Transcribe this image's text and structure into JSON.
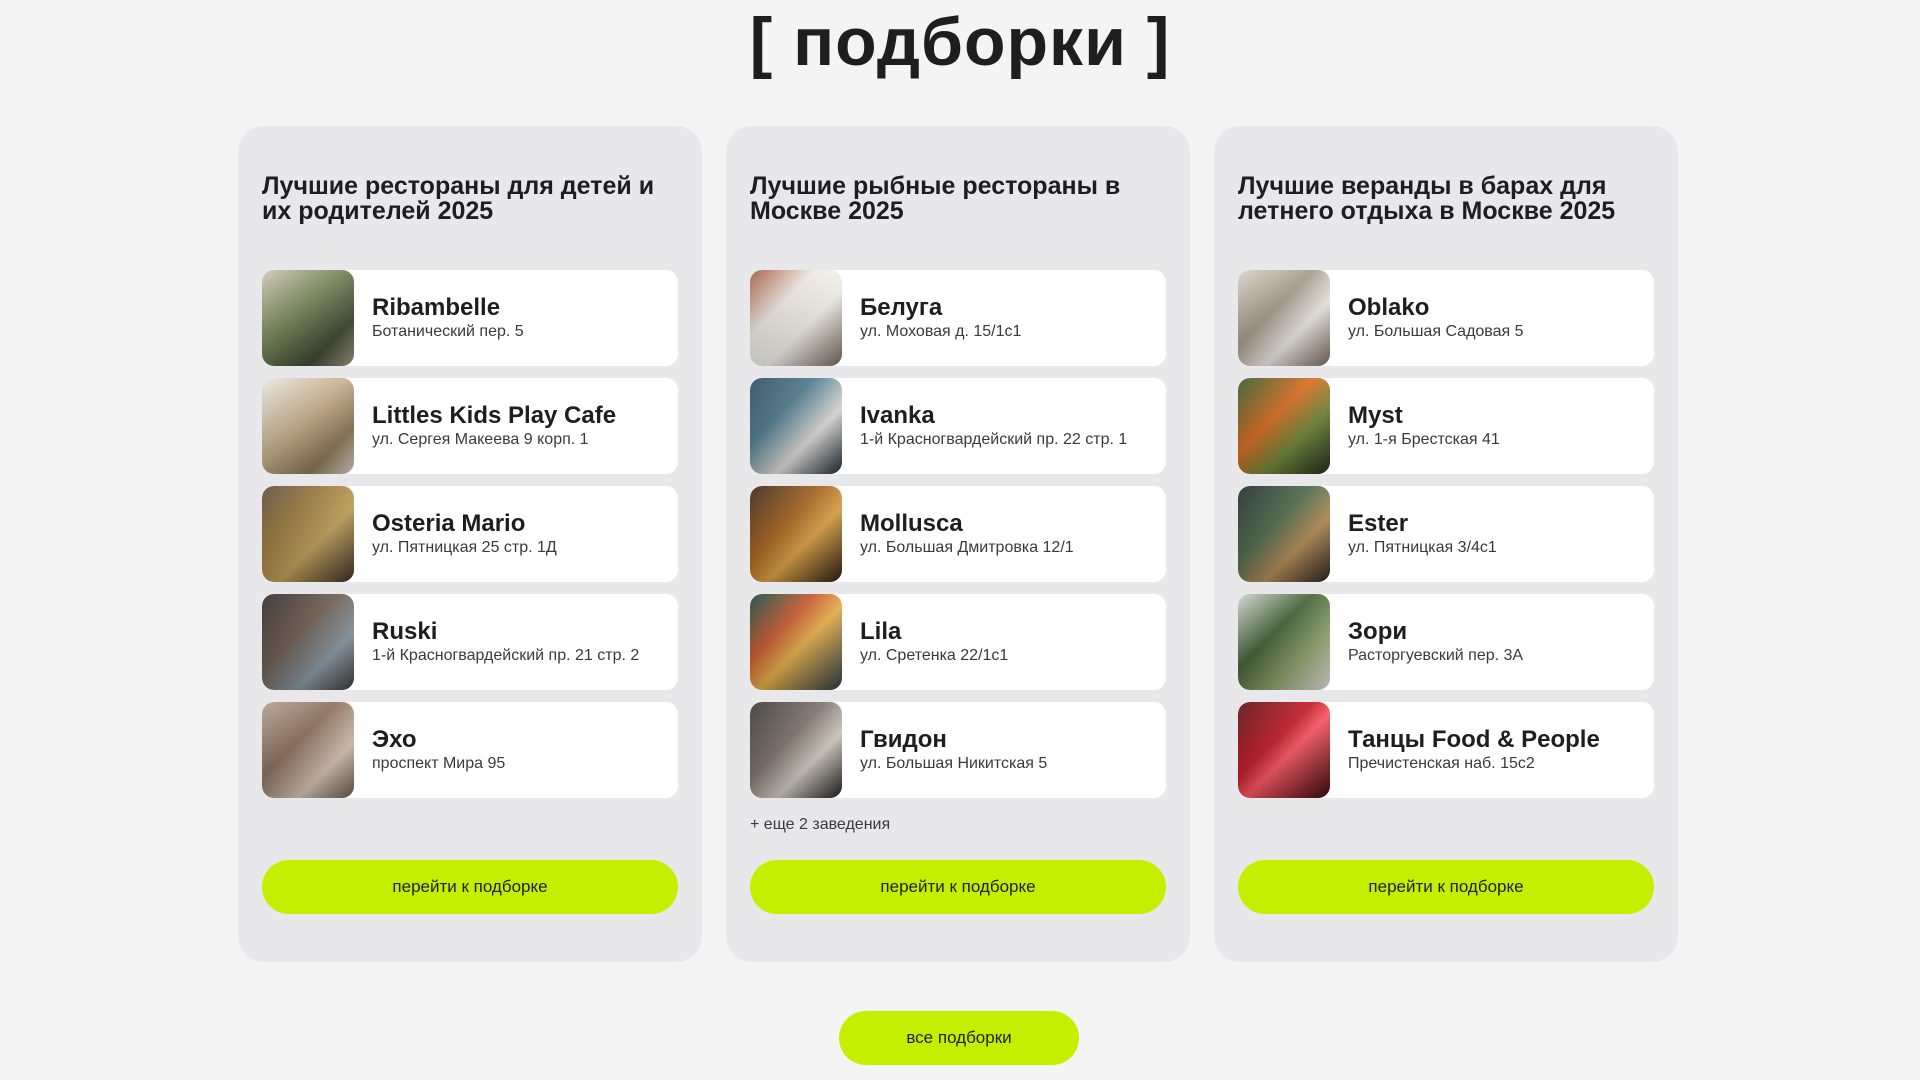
{
  "page": {
    "title": "[ подборки ]",
    "all_button": "все подборки"
  },
  "collections": [
    {
      "title": "Лучшие рестораны для детей и их родителей 2025",
      "items": [
        {
          "name": "Ribambelle",
          "address": "Ботанический пер. 5"
        },
        {
          "name": "Littles Kids Play Cafe",
          "address": "ул. Сергея Макеева 9 корп. 1"
        },
        {
          "name": "Osteria Mario",
          "address": "ул. Пятницкая 25 стр. 1Д"
        },
        {
          "name": "Ruski",
          "address": "1-й Красногвардейский пр. 21 стр. 2"
        },
        {
          "name": "Эхо",
          "address": "проспект Мира 95"
        }
      ],
      "more": "",
      "button": "перейти к подборке"
    },
    {
      "title": "Лучшие рыбные рестораны в Москве 2025",
      "items": [
        {
          "name": "Белуга",
          "address": "ул. Моховая д. 15/1с1"
        },
        {
          "name": "Ivanka",
          "address": "1-й Красногвардейский пр. 22 стр. 1"
        },
        {
          "name": "Mollusca",
          "address": "ул. Большая Дмитровка 12/1"
        },
        {
          "name": "Lila",
          "address": "ул. Сретенка 22/1с1"
        },
        {
          "name": "Гвидон",
          "address": "ул. Большая Никитская 5"
        }
      ],
      "more": "+ еще 2 заведения",
      "button": "перейти к подборке"
    },
    {
      "title": "Лучшие веранды в барах для летнего отдыха в Москве 2025",
      "items": [
        {
          "name": "Oblako",
          "address": "ул. Большая Садовая 5"
        },
        {
          "name": "Myst",
          "address": "ул. 1-я Брестская 41"
        },
        {
          "name": "Ester",
          "address": "ул. Пятницкая 3/4с1"
        },
        {
          "name": "Зори",
          "address": "Расторгуевский пер. 3А"
        },
        {
          "name": "Танцы Food & People",
          "address": "Пречистенская наб. 15с2"
        }
      ],
      "more": "",
      "button": "перейти к подборке"
    }
  ],
  "colors": {
    "accent": "#c4f000",
    "card_bg": "#e8e8ea",
    "page_bg": "#f4f4f5"
  }
}
